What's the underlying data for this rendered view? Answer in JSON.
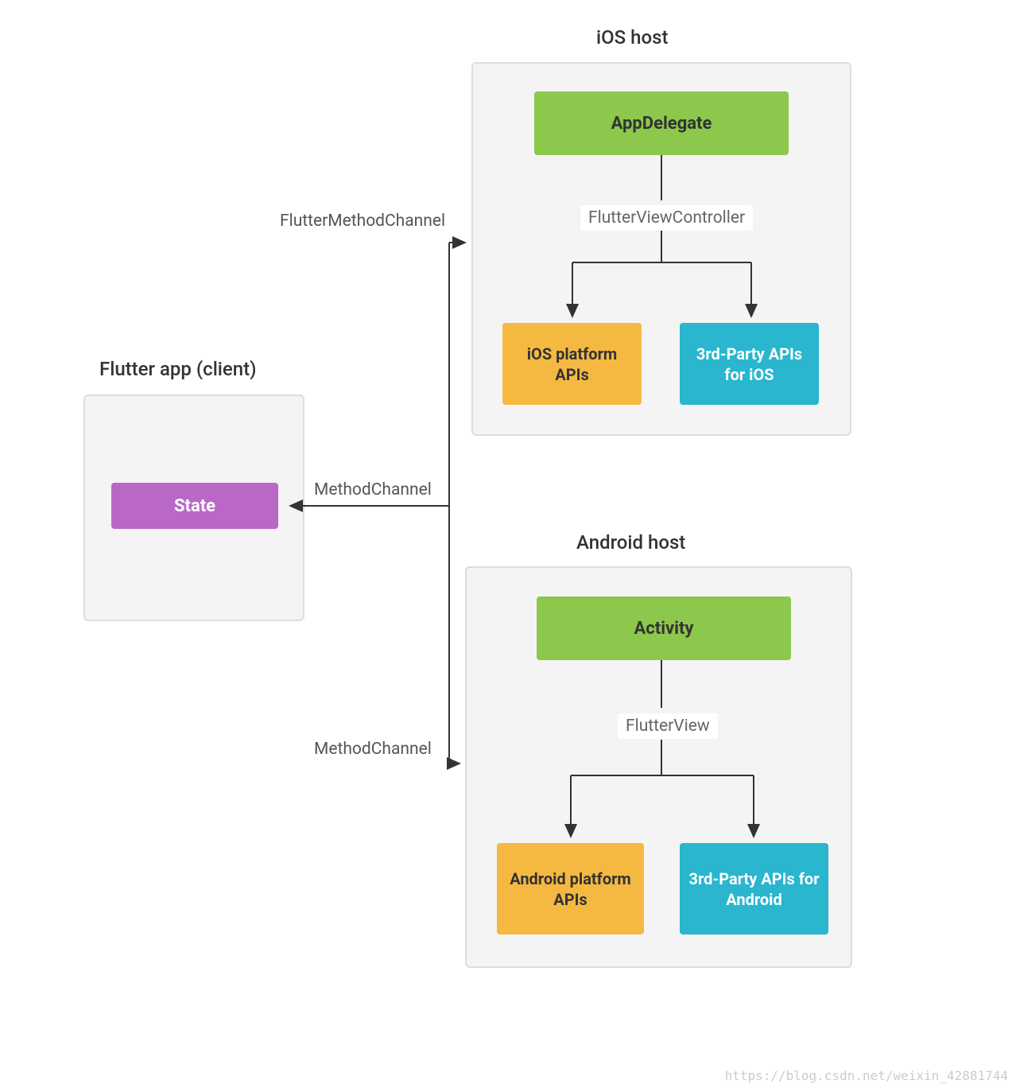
{
  "client": {
    "title": "Flutter app (client)",
    "state": "State"
  },
  "ios": {
    "title": "iOS host",
    "delegate": "AppDelegate",
    "viewCtrl": "FlutterViewController",
    "platform": "iOS platform APIs",
    "thirdParty": "3rd-Party APIs for iOS"
  },
  "android": {
    "title": "Android host",
    "activity": "Activity",
    "view": "FlutterView",
    "platform": "Android platform APIs",
    "thirdParty": "3rd-Party APIs for Android"
  },
  "labels": {
    "fmChannel": "FlutterMethodChannel",
    "mChannel1": "MethodChannel",
    "mChannel2": "MethodChannel"
  },
  "watermark": "https://blog.csdn.net/weixin_42881744"
}
